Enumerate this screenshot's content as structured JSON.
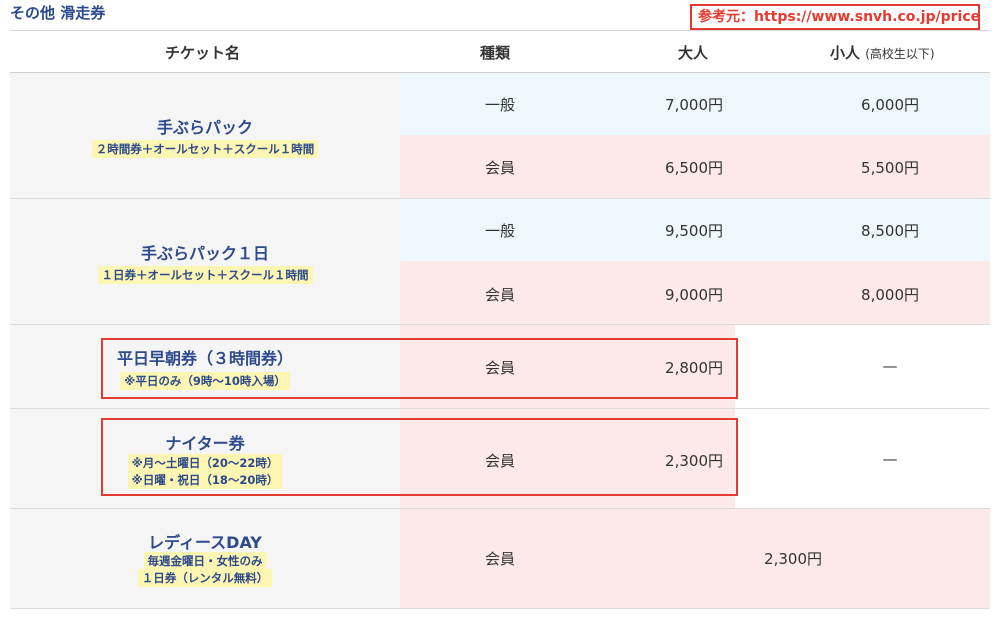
{
  "section": {
    "title": "その他 滑走券"
  },
  "source": {
    "text": "参考元：https://www.snvh.co.jp/price/"
  },
  "header": {
    "ticket_name": "チケット名",
    "kind": "種類",
    "adult": "大人",
    "child": "小人",
    "child_note": "(高校生以下)"
  },
  "rows": [
    {
      "name": "手ぶらパック",
      "subs": [
        "２時間券＋オールセット＋スクール１時間"
      ],
      "general": {
        "kind": "一般",
        "adult": "7,000円",
        "child": "6,000円"
      },
      "member": {
        "kind": "会員",
        "adult": "6,500円",
        "child": "5,500円"
      }
    },
    {
      "name": "手ぶらパック１日",
      "subs": [
        "１日券＋オールセット＋スクール１時間"
      ],
      "general": {
        "kind": "一般",
        "adult": "9,500円",
        "child": "8,500円"
      },
      "member": {
        "kind": "会員",
        "adult": "9,000円",
        "child": "8,000円"
      }
    },
    {
      "name": "平日早朝券（３時間券）",
      "subs": [
        "※平日のみ（9時〜10時入場）"
      ],
      "member": {
        "kind": "会員",
        "adult": "2,800円",
        "child": "—"
      }
    },
    {
      "name": "ナイター券",
      "subs": [
        "※月〜土曜日（20〜22時）",
        "※日曜・祝日（18〜20時）"
      ],
      "member": {
        "kind": "会員",
        "adult": "2,300円",
        "child": "—"
      }
    },
    {
      "name": "レディースDAY",
      "subs": [
        "毎週金曜日・女性のみ",
        "１日券（レンタル無料）"
      ],
      "member": {
        "kind": "会員",
        "merged_price": "2,300円"
      }
    }
  ],
  "colors": {
    "accent_text": "#2c4a8c",
    "highlight": "#fdf6b3",
    "general_bg": "#ecf8fd",
    "member_bg": "#fde9ea",
    "annotation_red": "#e53a2f"
  }
}
